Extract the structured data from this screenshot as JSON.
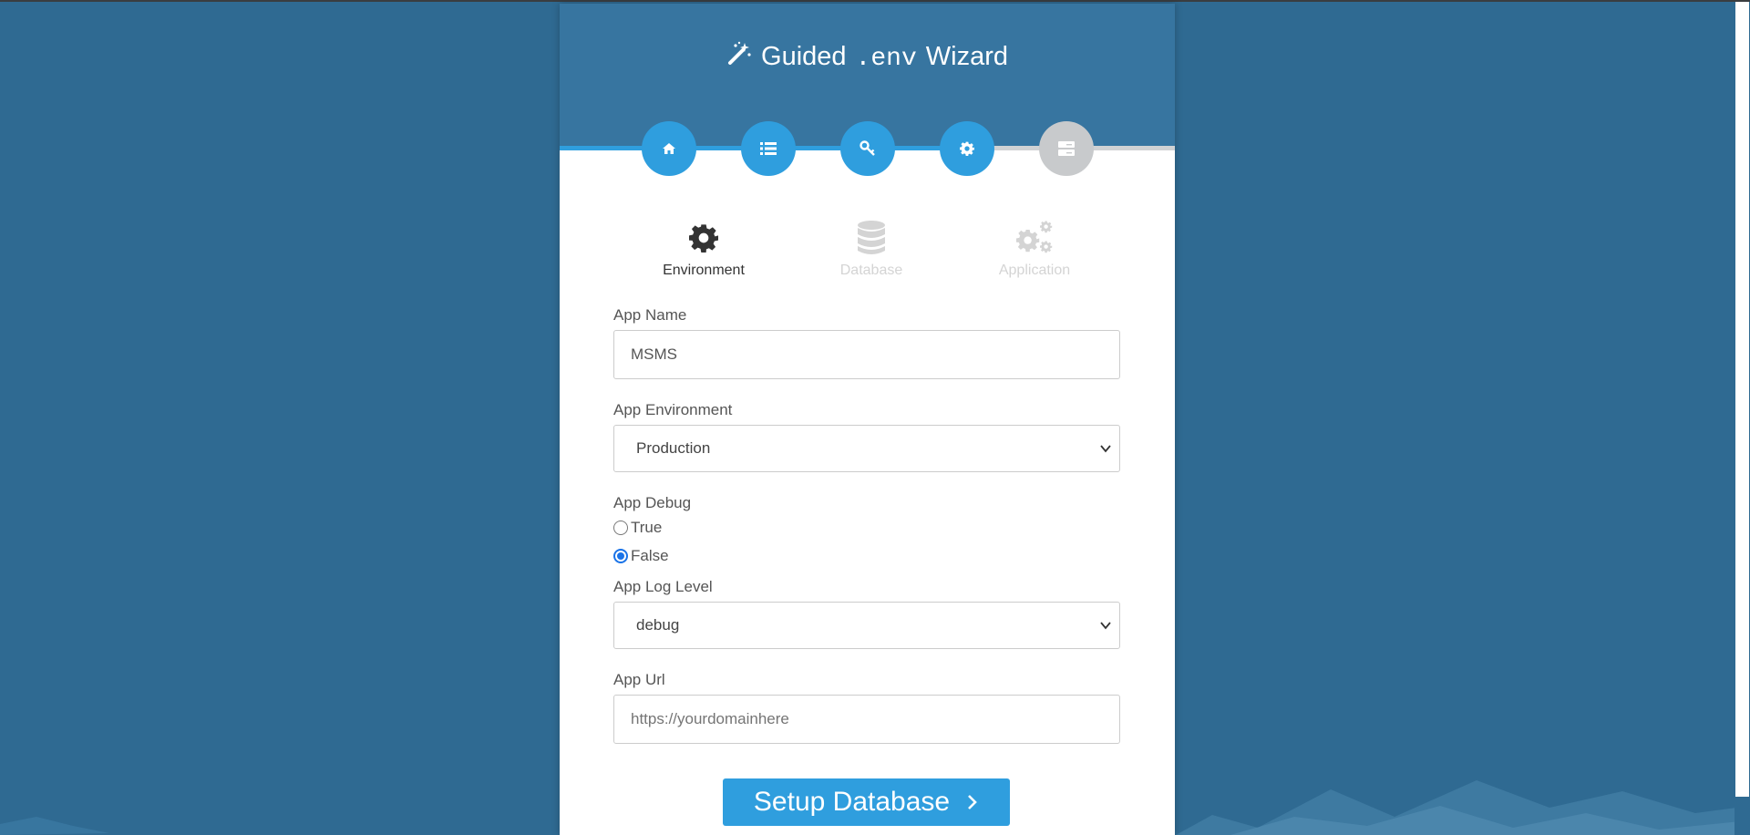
{
  "header": {
    "title_prefix": "Guided",
    "title_env": ".env",
    "title_suffix": "Wizard"
  },
  "steps": [
    {
      "icon": "home-icon",
      "state": "complete"
    },
    {
      "icon": "list-icon",
      "state": "complete"
    },
    {
      "icon": "key-icon",
      "state": "complete"
    },
    {
      "icon": "cog-icon",
      "state": "current"
    },
    {
      "icon": "server-icon",
      "state": "inactive"
    }
  ],
  "tabs": [
    {
      "label": "Environment",
      "icon": "cog-icon",
      "state": "active"
    },
    {
      "label": "Database",
      "icon": "database-icon",
      "state": "disabled"
    },
    {
      "label": "Application",
      "icon": "cogs-icon",
      "state": "disabled"
    }
  ],
  "form": {
    "app_name": {
      "label": "App Name",
      "value": "MSMS"
    },
    "app_environment": {
      "label": "App Environment",
      "selected": "Production"
    },
    "app_debug": {
      "label": "App Debug",
      "options": [
        "True",
        "False"
      ],
      "selected": "False"
    },
    "app_log_level": {
      "label": "App Log Level",
      "selected": "debug"
    },
    "app_url": {
      "label": "App Url",
      "placeholder": "https://yourdomainhere"
    }
  },
  "submit": {
    "label": "Setup Database"
  },
  "colors": {
    "background": "#2f6a92",
    "header": "#3775a0",
    "accent": "#2f9ede",
    "inactive": "#c8cacc"
  }
}
